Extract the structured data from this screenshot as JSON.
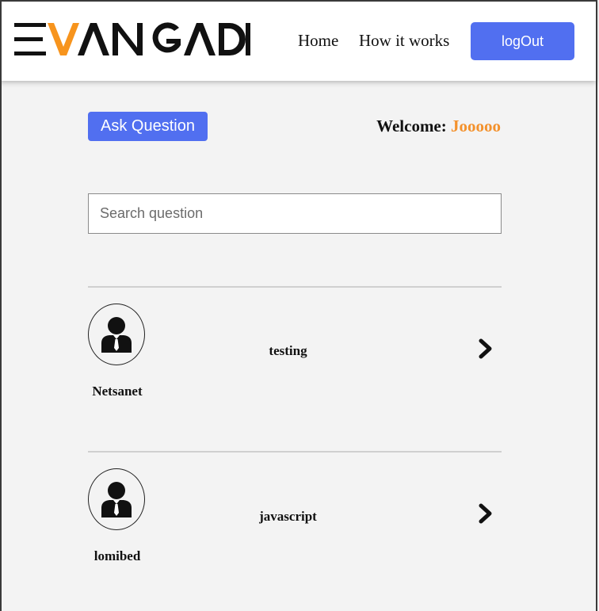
{
  "header": {
    "logo_text": "EVANGADI",
    "nav": [
      {
        "label": "Home"
      },
      {
        "label": "How it works"
      }
    ],
    "logout_label": "logOut"
  },
  "main": {
    "ask_button_label": "Ask Question",
    "welcome_prefix": "Welcome:",
    "welcome_user": "Jooooo",
    "search_placeholder": "Search question",
    "questions": [
      {
        "username": "Netsanet",
        "title": "testing"
      },
      {
        "username": "lomibed",
        "title": "javascript"
      }
    ]
  },
  "colors": {
    "accent": "#516ff0",
    "username_highlight": "#f3912c",
    "logo_orange": "#f7941d"
  }
}
